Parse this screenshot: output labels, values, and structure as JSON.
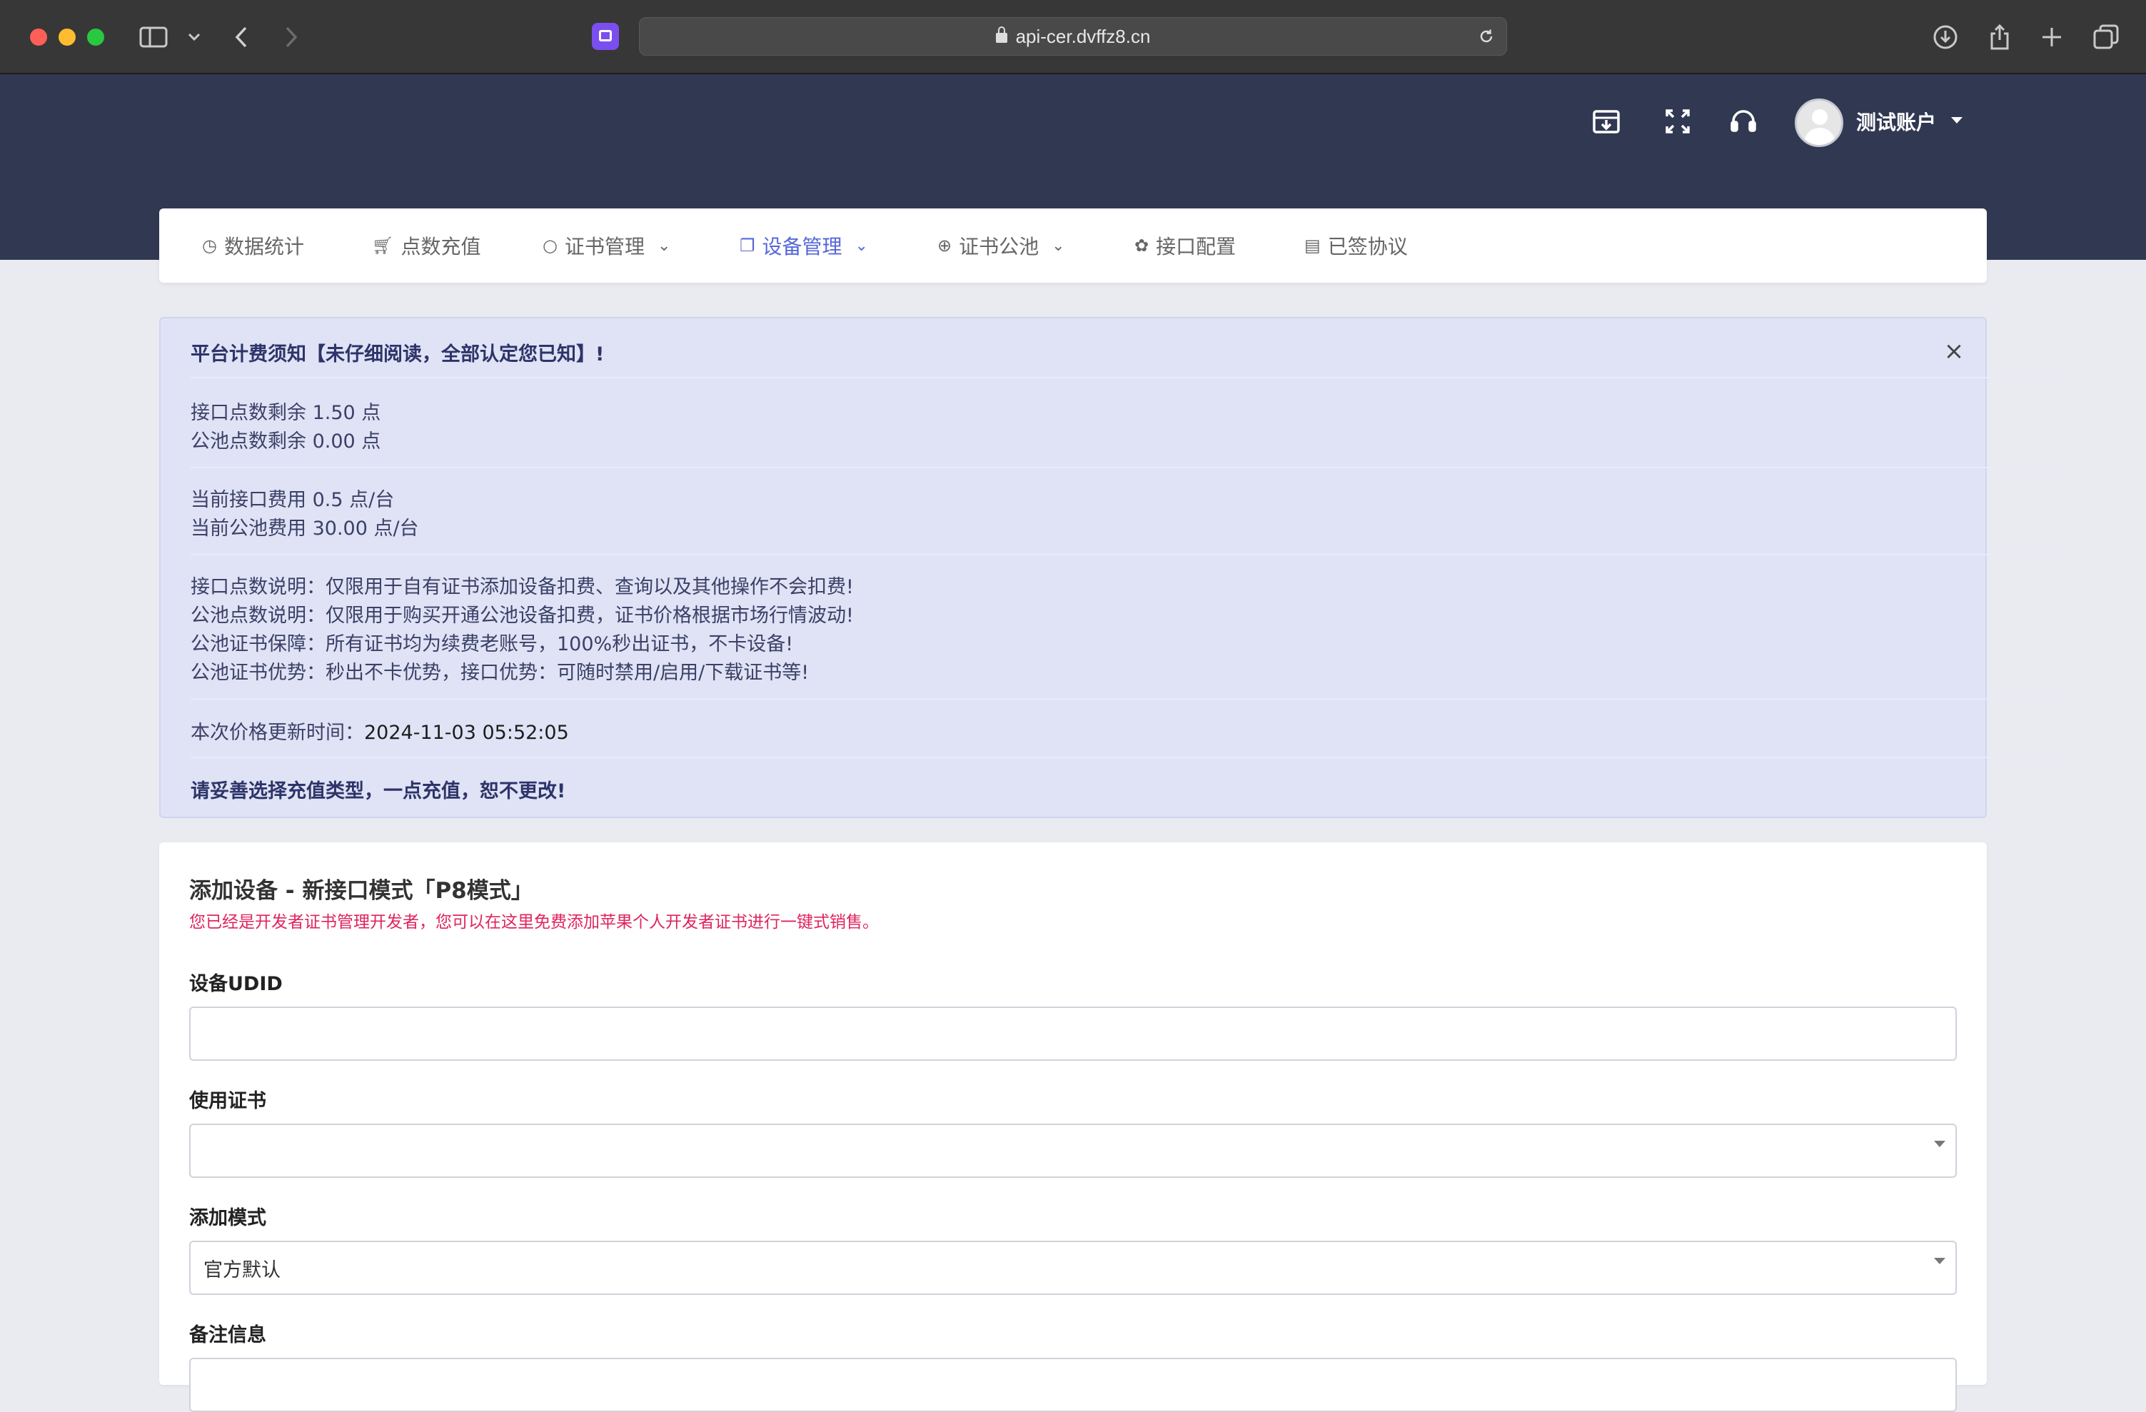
{
  "browser": {
    "url": "api-cer.dvffz8.cn"
  },
  "header": {
    "account_name": "测试账户"
  },
  "nav": {
    "items": [
      {
        "label": "数据统计",
        "icon": "◷",
        "dropdown": false,
        "active": false
      },
      {
        "label": "点数充值",
        "icon": "🛒︎",
        "dropdown": false,
        "active": false
      },
      {
        "label": "证书管理",
        "icon": "○",
        "dropdown": true,
        "active": false
      },
      {
        "label": "设备管理",
        "icon": "❐",
        "dropdown": true,
        "active": true
      },
      {
        "label": "证书公池",
        "icon": "⊕",
        "dropdown": true,
        "active": false
      },
      {
        "label": "接口配置",
        "icon": "✿",
        "dropdown": false,
        "active": false
      },
      {
        "label": "已签协议",
        "icon": "▤",
        "dropdown": false,
        "active": false
      }
    ],
    "chevron": "⌄"
  },
  "notice": {
    "title": "平台计费须知【未仔细阅读，全部认定您已知】!",
    "api_points": "接口点数剩余 1.50 点",
    "pool_points": "公池点数剩余 0.00 点",
    "api_fee": "当前接口费用 0.5 点/台",
    "pool_fee": "当前公池费用 30.00 点/台",
    "desc1": "接口点数说明：仅限用于自有证书添加设备扣费、查询以及其他操作不会扣费!",
    "desc2": "公池点数说明：仅限用于购买开通公池设备扣费，证书价格根据市场行情波动!",
    "desc3": "公池证书保障：所有证书均为续费老账号，100%秒出证书，不卡设备!",
    "desc4": "公池证书优势：秒出不卡优势，接口优势：可随时禁用/启用/下载证书等!",
    "update_label": "本次价格更新时间：",
    "update_time": "2024-11-03 05:52:05",
    "warning": "请妥善选择充值类型，一点充值，恕不更改!",
    "close": "×"
  },
  "form": {
    "title": "添加设备 - 新接口模式「P8模式」",
    "subtitle": "您已经是开发者证书管理开发者，您可以在这里免费添加苹果个人开发者证书进行一键式销售。",
    "udid_label": "设备UDID",
    "udid_value": "",
    "cert_label": "使用证书",
    "cert_value": "",
    "mode_label": "添加模式",
    "mode_value": "官方默认",
    "remark_label": "备注信息"
  }
}
